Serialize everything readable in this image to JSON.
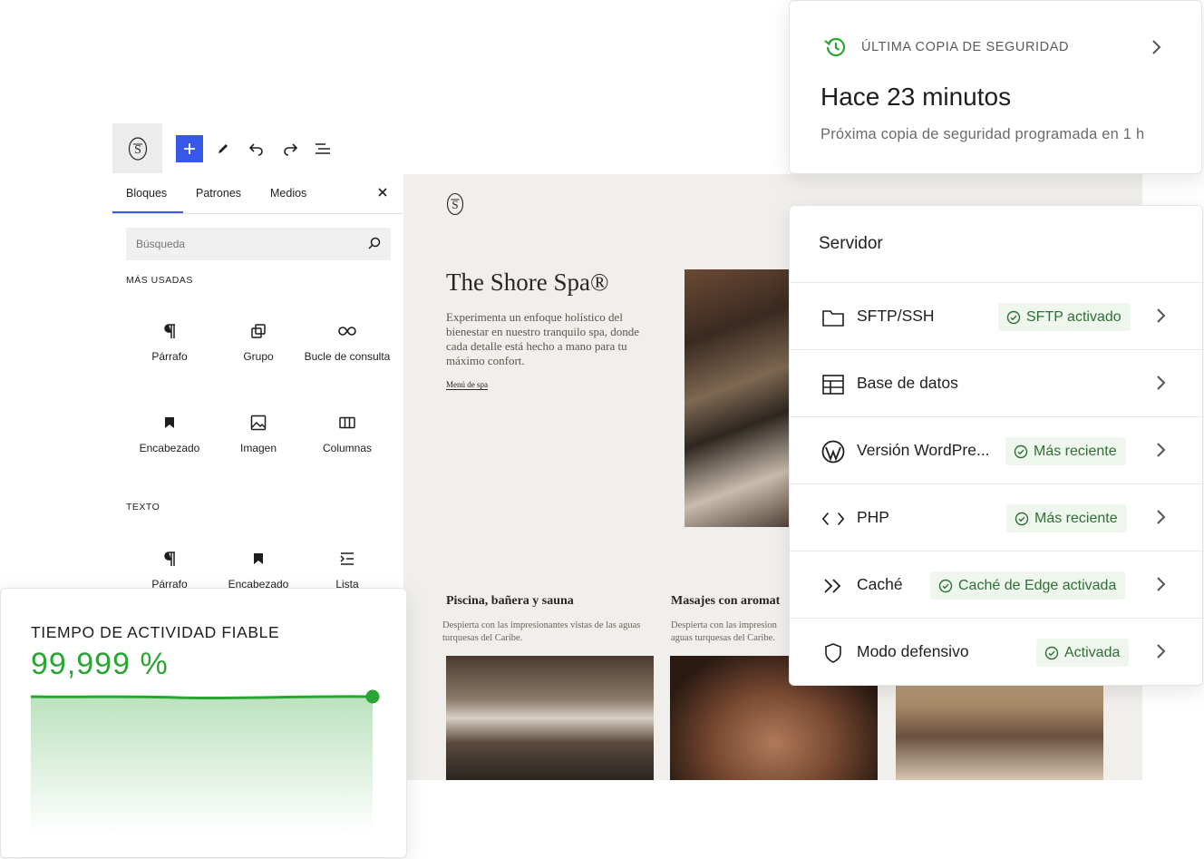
{
  "toolbar": {
    "icons": [
      "site-logo-icon",
      "plus-icon",
      "pencil-icon",
      "undo-icon",
      "redo-icon",
      "list-view-icon"
    ]
  },
  "inserter": {
    "tabs": [
      "Bloques",
      "Patrones",
      "Medios"
    ],
    "active_tab": "Bloques",
    "search_placeholder": "Búsqueda",
    "most_used_title": "MÁS USADAS",
    "most_used": [
      {
        "label": "Párrafo",
        "icon": "paragraph-icon"
      },
      {
        "label": "Grupo",
        "icon": "group-icon"
      },
      {
        "label": "Bucle de consulta",
        "icon": "loop-icon"
      },
      {
        "label": "Encabezado",
        "icon": "bookmark-icon"
      },
      {
        "label": "Imagen",
        "icon": "image-icon"
      },
      {
        "label": "Columnas",
        "icon": "columns-icon"
      }
    ],
    "text_title": "TEXTO",
    "text_blocks": [
      {
        "label": "Párrafo",
        "icon": "paragraph-icon"
      },
      {
        "label": "Encabezado",
        "icon": "bookmark-icon"
      },
      {
        "label": "Lista",
        "icon": "list-icon"
      }
    ],
    "accent": "#3858e9"
  },
  "preview": {
    "title": "The Shore Spa®",
    "description": "Experimenta un enfoque holístico del bienestar en nuestro tranquilo spa, donde cada detalle está hecho a mano para tu máximo confort.",
    "link": "Menú de spa",
    "columns": [
      {
        "title": "Piscina, bañera y sauna",
        "desc": "Despierta con las impresionantes vistas de las aguas turquesas del Caribe."
      },
      {
        "title": "Masajes con aromat",
        "desc": "Despierta con las impresion aguas turquesas del Caribe."
      }
    ]
  },
  "backup": {
    "label": "ÚLTIMA COPIA DE SEGURIDAD",
    "time": "Hace 23 minutos",
    "next": "Próxima copia de seguridad programada en 1 h",
    "icon": "history-icon"
  },
  "server": {
    "title": "Servidor",
    "rows": [
      {
        "name": "SFTP/SSH",
        "badge": "SFTP activado",
        "icon": "folder-icon"
      },
      {
        "name": "Base de datos",
        "badge": "",
        "icon": "table-icon"
      },
      {
        "name": "Versión WordPre...",
        "badge": "Más reciente",
        "icon": "wordpress-icon"
      },
      {
        "name": "PHP",
        "badge": "Más reciente",
        "icon": "code-icon"
      },
      {
        "name": "Caché",
        "badge": "Caché de Edge activada",
        "icon": "double-chevron-icon"
      },
      {
        "name": "Modo defensivo",
        "badge": "Activada",
        "icon": "shield-icon"
      }
    ],
    "badge_color": "#2f6f35"
  },
  "uptime": {
    "label": "TIEMPO DE ACTIVIDAD FIABLE",
    "value": "99,999 %",
    "color": "#2aa534"
  }
}
